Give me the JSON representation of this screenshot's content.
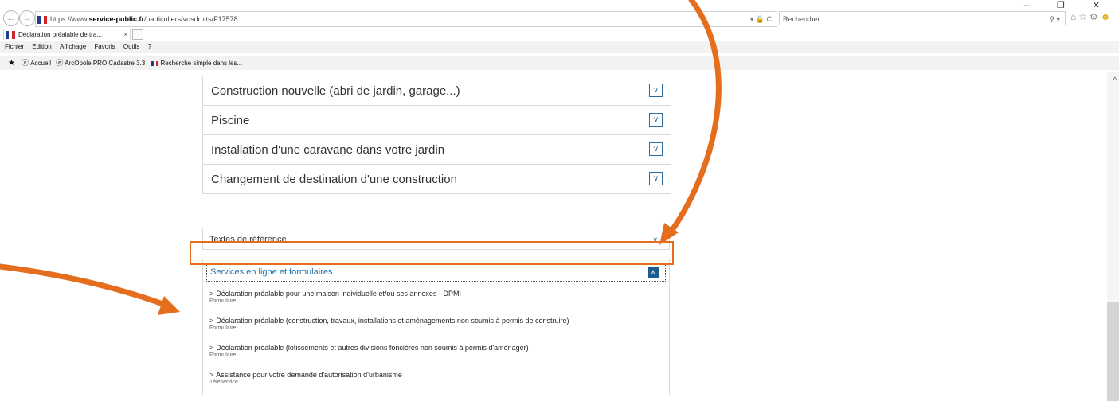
{
  "browser": {
    "url_prefix": "https://www.",
    "url_domain": "service-public.fr",
    "url_path": "/particuliers/vosdroits/F17578",
    "addr_icons": "▾ 🔒 C",
    "search_placeholder": "Rechercher...",
    "tab_title": "Déclaration préalable de tra...",
    "tab_close": "×",
    "menu": [
      "Fichier",
      "Edition",
      "Affichage",
      "Favoris",
      "Outils",
      "?"
    ],
    "favorites": [
      "Accueil",
      "ArcOpole PRO Cadastre 3.3",
      "Recherche simple dans les..."
    ],
    "window_controls": "–  ❐  ✕"
  },
  "accordion_top": {
    "items": [
      {
        "label": "Construction nouvelle (abri de jardin, garage...)",
        "chevron": "∨"
      },
      {
        "label": "Piscine",
        "chevron": "∨"
      },
      {
        "label": "Installation d'une caravane dans votre jardin",
        "chevron": "∨"
      },
      {
        "label": "Changement de destination d'une construction",
        "chevron": "∨"
      }
    ]
  },
  "textes_reference": {
    "label": "Textes de référence",
    "chevron": "∨"
  },
  "services": {
    "header": "Services en ligne et formulaires",
    "toggle": "∧",
    "items": [
      {
        "title": "Déclaration préalable pour une maison individuelle et/ou ses annexes - DPMI",
        "type": "Formulaire"
      },
      {
        "title": "Déclaration préalable (construction, travaux, installations et aménagements non soumis à permis de construire)",
        "type": "Formulaire"
      },
      {
        "title": "Déclaration préalable (lotissements et autres divisions foncières non soumis à permis d'aménager)",
        "type": "Formulaire"
      },
      {
        "title": "Assistance pour votre demande d'autorisation d'urbanisme",
        "type": "Téléservice"
      }
    ]
  },
  "annotation": {
    "color": "#e46e1e"
  }
}
